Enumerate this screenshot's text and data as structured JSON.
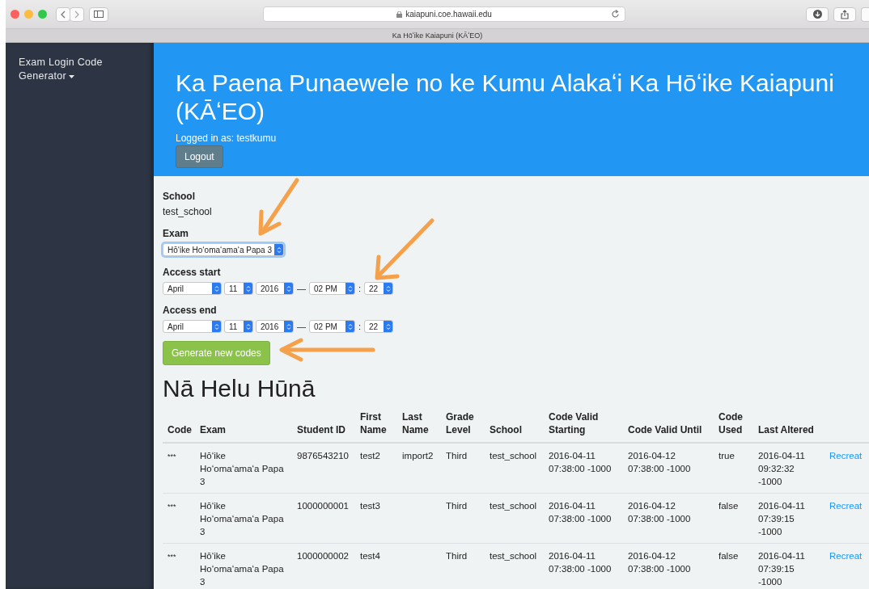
{
  "browser": {
    "url": "kaiapuni.coe.hawaii.edu",
    "tab_title": "Ka Hōʻike Kaiapuni (KĀʻEO)"
  },
  "sidebar": {
    "menu": "Exam Login Code Generator"
  },
  "header": {
    "title": "Ka Paena Punaewele no ke Kumu Alakaʻi Ka Hōʻike Kaiapuni (KĀʻEO)",
    "logged_in": "Logged in as: testkumu",
    "logout": "Logout"
  },
  "form": {
    "school_label": "School",
    "school": "test_school",
    "exam_label": "Exam",
    "exam": {
      "value": "Hōʻike Hoʻomaʻamaʻa Papa 3",
      "focused": true
    },
    "access": [
      {
        "label": "Access start",
        "month": "April",
        "day": "11",
        "year": "2016",
        "dash": "—",
        "hour": "02 PM",
        "colon": ":",
        "minute": "22"
      },
      {
        "label": "Access end",
        "month": "April",
        "day": "11",
        "year": "2016",
        "dash": "—",
        "hour": "02 PM",
        "colon": ":",
        "minute": "22"
      }
    ],
    "generate": "Generate new codes"
  },
  "codes": {
    "title": "Nā Helu Hūnā",
    "columns": [
      "Code",
      "Exam",
      "Student ID",
      "First Name",
      "Last Name",
      "Grade Level",
      "School",
      "Code Valid Starting",
      "Code Valid Until",
      "Code Used",
      "Last Altered"
    ],
    "rows": [
      {
        "cells": [
          "***",
          "Hōʻike Hoʻomaʻamaʻa Papa 3",
          "9876543210",
          "test2",
          "import2",
          "Third",
          "test_school",
          "2016-04-11 07:38:00 -1000",
          "2016-04-12 07:38:00 -1000",
          "true",
          "2016-04-11 09:32:32 -1000"
        ],
        "action": "Recreat"
      },
      {
        "cells": [
          "***",
          "Hōʻike Hoʻomaʻamaʻa Papa 3",
          "1000000001",
          "test3",
          "",
          "Third",
          "test_school",
          "2016-04-11 07:38:00 -1000",
          "2016-04-12 07:38:00 -1000",
          "false",
          "2016-04-11 07:39:15 -1000"
        ],
        "action": "Recreat"
      },
      {
        "cells": [
          "***",
          "Hōʻike Hoʻomaʻamaʻa Papa 3",
          "1000000002",
          "test4",
          "",
          "Third",
          "test_school",
          "2016-04-11 07:38:00 -1000",
          "2016-04-12 07:38:00 -1000",
          "false",
          "2016-04-11 07:39:15 -1000"
        ],
        "action": "Recreat"
      }
    ]
  }
}
